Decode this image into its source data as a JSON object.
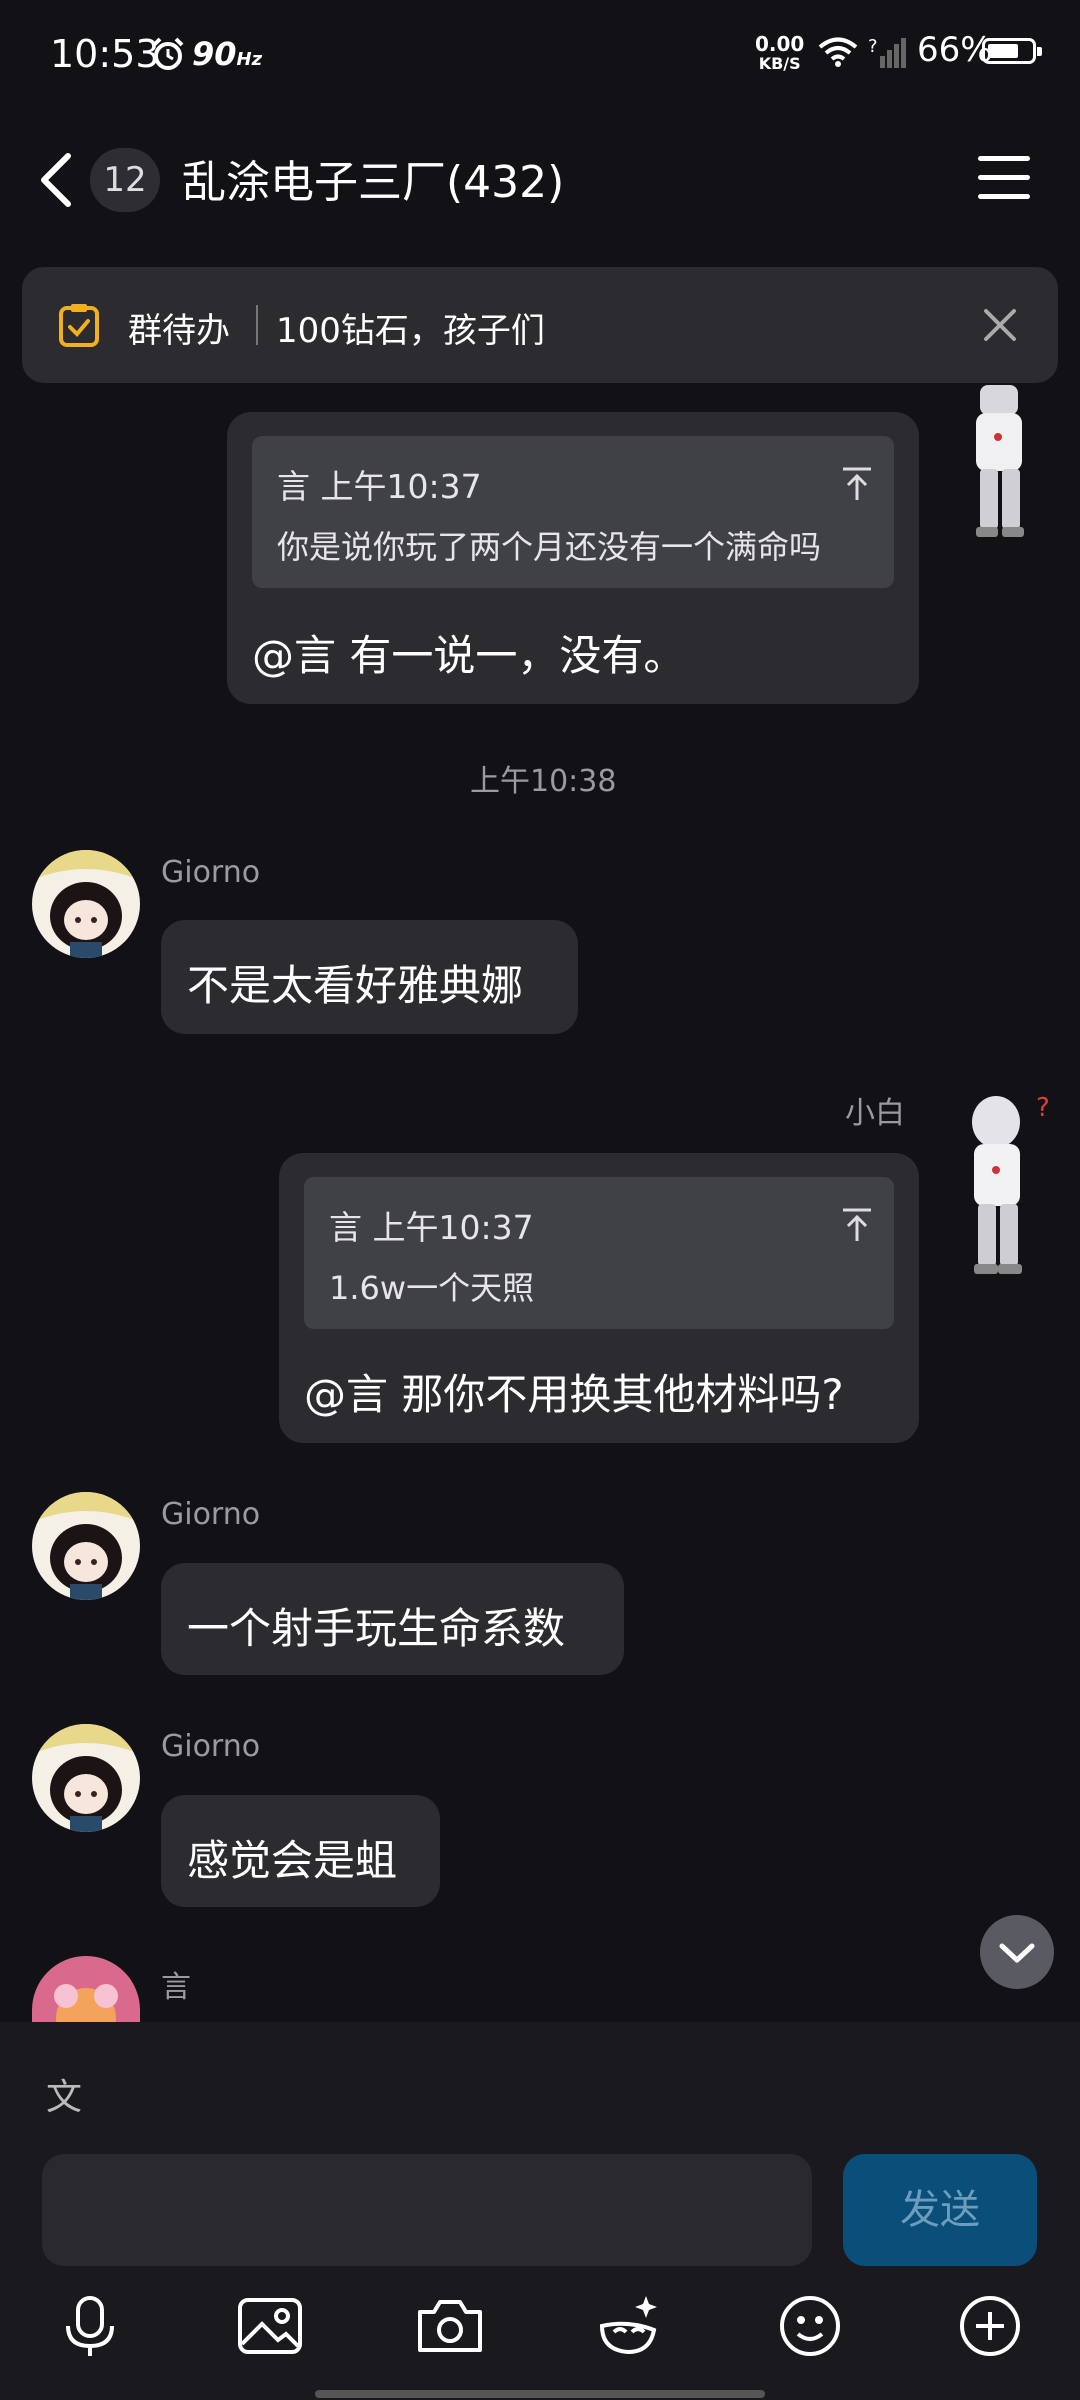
{
  "status_bar": {
    "time": "10:53",
    "refresh_rate": "90",
    "refresh_unit": "Hz",
    "net_speed_value": "0.00",
    "net_speed_unit": "KB/S",
    "battery": "66%"
  },
  "header": {
    "unread_count": "12",
    "title": "乱涂电子三厂(432)"
  },
  "todo_banner": {
    "label": "群待办",
    "text": "100钻石，孩子们"
  },
  "messages": {
    "m1": {
      "quote_header": "言 上午10:37",
      "quote_text": "你是说你玩了两个月还没有一个满命吗",
      "text": "@言 有一说一，没有。"
    },
    "timestamp": "上午10:38",
    "m2": {
      "sender": "Giorno",
      "text": "不是太看好雅典娜"
    },
    "m3": {
      "sender": "小白",
      "quote_header": "言 上午10:37",
      "quote_text": "1.6w一个天照",
      "text": "@言 那你不用换其他材料吗?"
    },
    "m4": {
      "sender": "Giorno",
      "text": "一个射手玩生命系数"
    },
    "m5": {
      "sender": "Giorno",
      "text": "感觉会是蛆"
    },
    "m6": {
      "sender": "言"
    }
  },
  "composer": {
    "translate_glyph": "文",
    "send_label": "发送"
  },
  "colors": {
    "background": "#111116",
    "bubble": "#2b2b30",
    "quote": "#404047",
    "send_button": "#0a4f7a",
    "todo_icon": "#f2b01e"
  }
}
